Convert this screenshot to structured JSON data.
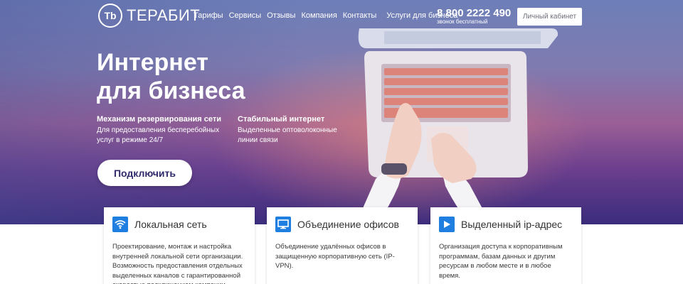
{
  "brand": {
    "logo_mark": "Tb",
    "name": "ТЕРАБИТ"
  },
  "nav": {
    "items": [
      "Тарифы",
      "Сервисы",
      "Отзывы",
      "Компания",
      "Контакты"
    ],
    "business": "Услуги для бизнеса"
  },
  "phone": {
    "number": "8 800 2222 490",
    "note": "звонок бесплатный"
  },
  "account_button": "Личный кабинет",
  "hero": {
    "title_line1": "Интернет",
    "title_line2": "для бизнеса",
    "features": [
      {
        "title": "Механизм резервирования сети",
        "line1": "Для предоставления бесперебойных",
        "line2": "услуг в режиме 24/7"
      },
      {
        "title": "Стабильный интернет",
        "line1": "Выделенные оптоволоконные",
        "line2": "линии связи"
      }
    ],
    "cta": "Подключить"
  },
  "cards": [
    {
      "icon": "wifi-icon",
      "title": "Локальная сеть",
      "text": "Проектирование, монтаж и настройка внутренней локальной сети организации. Возможность предоставления отдельных выделенных каналов с гарантированной скоростью подключением компании"
    },
    {
      "icon": "monitor-icon",
      "title": "Объединение офисов",
      "text": "Объединение удалённых офисов в защищенную корпоративную сеть (IP-VPN)."
    },
    {
      "icon": "play-icon",
      "title": "Выделенный ip-адрес",
      "text": "Организация доступа к корпоративным программам, базам данных и другим ресурсам в любом месте и в любое время."
    }
  ],
  "colors": {
    "accent": "#1f7fe0",
    "cta_text": "#2f2a6b"
  }
}
